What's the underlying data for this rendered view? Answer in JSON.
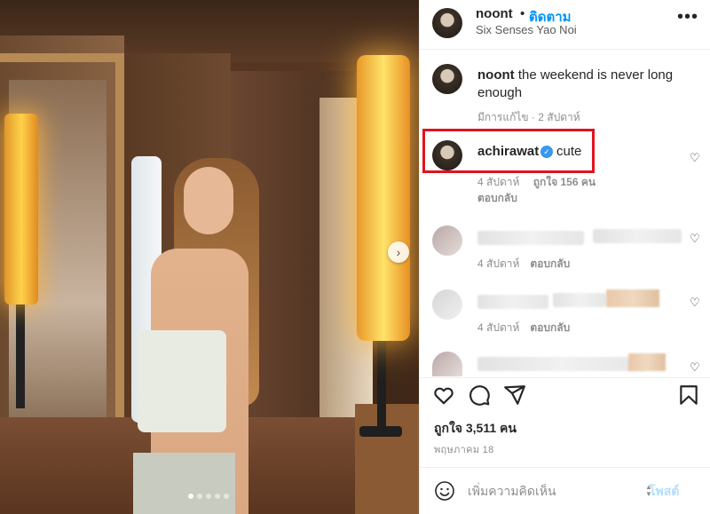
{
  "header": {
    "username": "noont",
    "separator": "•",
    "follow_label": "ติดตาม",
    "location": "Six Senses Yao Noi",
    "more_label": "•••"
  },
  "caption": {
    "username": "noont",
    "text": "the weekend is never long enough",
    "meta": "มีการแก้ไข · 2 สัปดาห์"
  },
  "comments": [
    {
      "username": "achirawat",
      "verified": true,
      "text": "cute",
      "time": "4 สัปดาห์",
      "likes": "ถูกใจ 156 คน",
      "reply_label": "ตอบกลับ"
    },
    {
      "username": "",
      "text": "",
      "time": "4 สัปดาห์",
      "reply_label": "ตอบกลับ"
    },
    {
      "username": "",
      "text": "",
      "time": "4 สัปดาห์",
      "reply_label": "ตอบกลับ"
    }
  ],
  "post": {
    "likes": "ถูกใจ 3,511 คน",
    "date": "พฤษภาคม 18"
  },
  "composer": {
    "placeholder": "เพิ่มความคิดเห็น",
    "post_label": "โพสต์"
  },
  "carousel": {
    "next_icon": "chevron-right-icon",
    "slide_count": 5,
    "active_slide": 1
  },
  "colors": {
    "accent": "#0095f6",
    "highlight": "#e0141e",
    "verified": "#3897f0"
  }
}
